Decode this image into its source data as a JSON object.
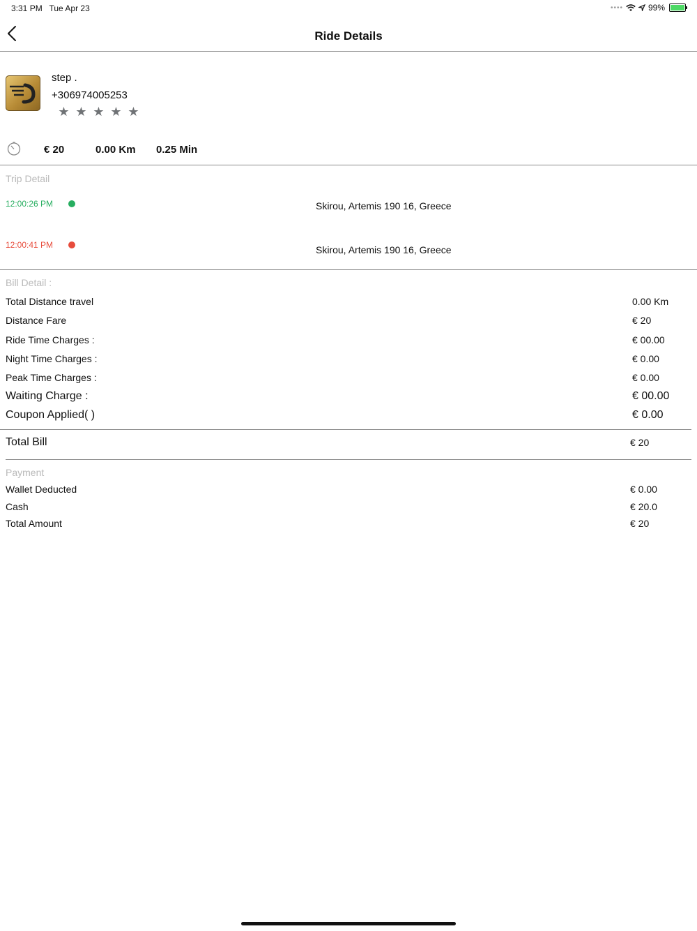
{
  "status_bar": {
    "time": "3:31 PM",
    "date": "Tue Apr 23",
    "battery": "99%",
    "battery_level": 0.99
  },
  "nav": {
    "title": "Ride Details",
    "back_icon": "chevron-left-icon"
  },
  "driver": {
    "name": "step .",
    "phone": "+306974005253",
    "rating": 5,
    "rating_max": 5
  },
  "summary": {
    "fare": "€ 20",
    "distance": "0.00 Km",
    "duration": "0.25 Min",
    "icon": "timer-icon"
  },
  "trip": {
    "label": "Trip Detail",
    "pickup": {
      "time": "12:00:26 PM",
      "address": "Skirou, Artemis 190 16, Greece",
      "color": "#27ae60"
    },
    "dropoff": {
      "time": "12:00:41 PM",
      "address": "Skirou, Artemis 190 16, Greece",
      "color": "#e74c3c"
    }
  },
  "bill": {
    "label": "Bill Detail :",
    "rows": [
      {
        "label": "Total Distance travel",
        "value": "0.00 Km"
      },
      {
        "label": "Distance Fare",
        "value": "€ 20"
      },
      {
        "label": "Ride Time Charges :",
        "value": "€ 00.00"
      },
      {
        "label": "Night Time Charges :",
        "value": "€ 0.00"
      },
      {
        "label": "Peak Time Charges :",
        "value": "€ 0.00"
      },
      {
        "label": "Waiting Charge :",
        "value": "€ 00.00"
      },
      {
        "label": "Coupon Applied(  )",
        "value": "€ 0.00"
      }
    ],
    "total_label": "Total Bill",
    "total_value": "€ 20"
  },
  "payment": {
    "label": "Payment",
    "rows": [
      {
        "label": "Wallet Deducted",
        "value": "€ 0.00"
      },
      {
        "label": "Cash",
        "value": "€ 20.0"
      },
      {
        "label": "Total Amount",
        "value": "€ 20"
      }
    ]
  }
}
